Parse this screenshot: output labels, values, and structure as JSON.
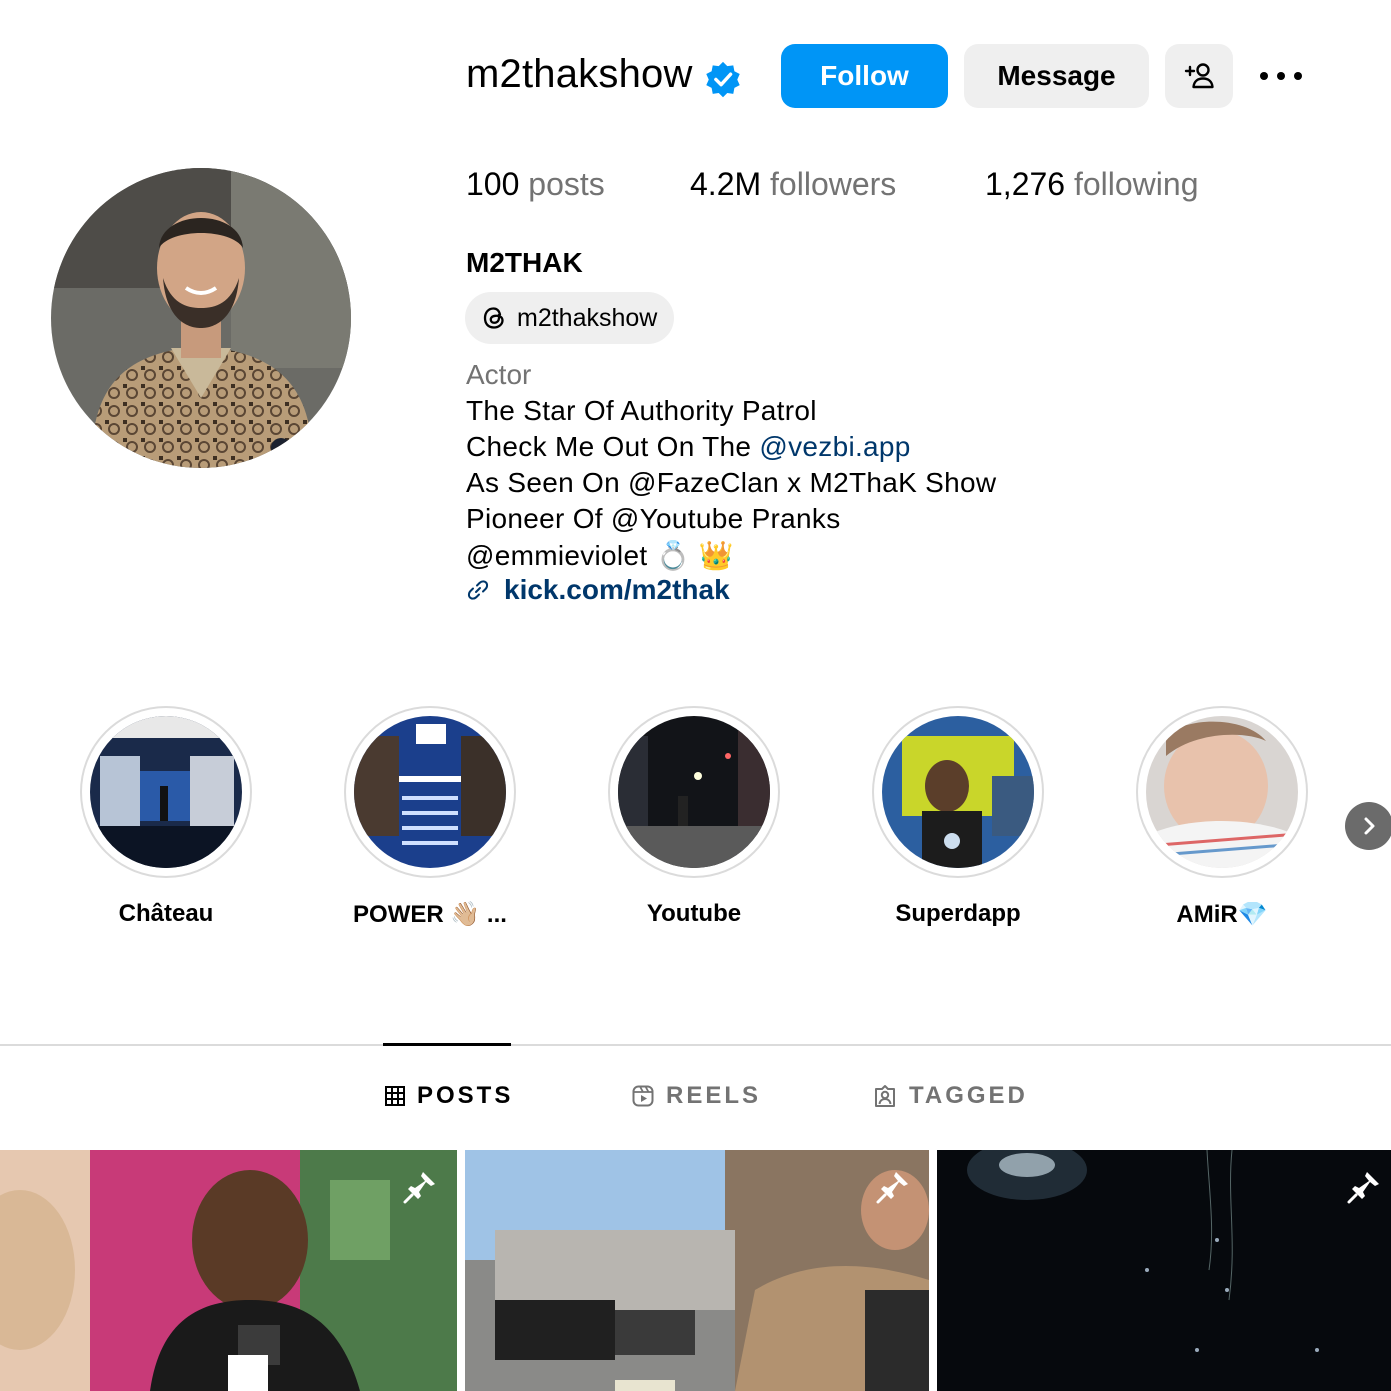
{
  "header": {
    "username": "m2thakshow",
    "follow_label": "Follow",
    "message_label": "Message"
  },
  "stats": {
    "posts_count": "100",
    "posts_label": "posts",
    "followers_count": "4.2M",
    "followers_label": "followers",
    "following_count": "1,276",
    "following_label": "following"
  },
  "profile": {
    "full_name": "M2THAK",
    "threads_handle": "m2thakshow",
    "category": "Actor",
    "bio": {
      "line1": "The Star Of Authority Patrol",
      "line2_prefix": "Check Me Out On The ",
      "line2_mention": "@vezbi.app",
      "line3": "As Seen On @FazeClan x M2ThaK Show",
      "line4": "Pioneer Of @Youtube Pranks",
      "line5": "@emmieviolet 💍 👑"
    },
    "link": "kick.com/m2thak"
  },
  "highlights": [
    {
      "label": "Château"
    },
    {
      "label": "POWER 👋🏼 ..."
    },
    {
      "label": "Youtube"
    },
    {
      "label": "Superdapp"
    },
    {
      "label": "AMiR💎"
    }
  ],
  "tabs": [
    {
      "label": "POSTS",
      "active": true
    },
    {
      "label": "REELS",
      "active": false
    },
    {
      "label": "TAGGED",
      "active": false
    }
  ],
  "colors": {
    "accent": "#0095f6",
    "link": "#00376b",
    "muted": "#737373",
    "button_bg": "#efefef"
  },
  "icons": [
    "verified-badge-icon",
    "add-user-icon",
    "more-options-icon",
    "threads-icon",
    "link-icon",
    "chevron-right-icon",
    "grid-icon",
    "reels-icon",
    "tagged-icon",
    "pin-icon"
  ]
}
